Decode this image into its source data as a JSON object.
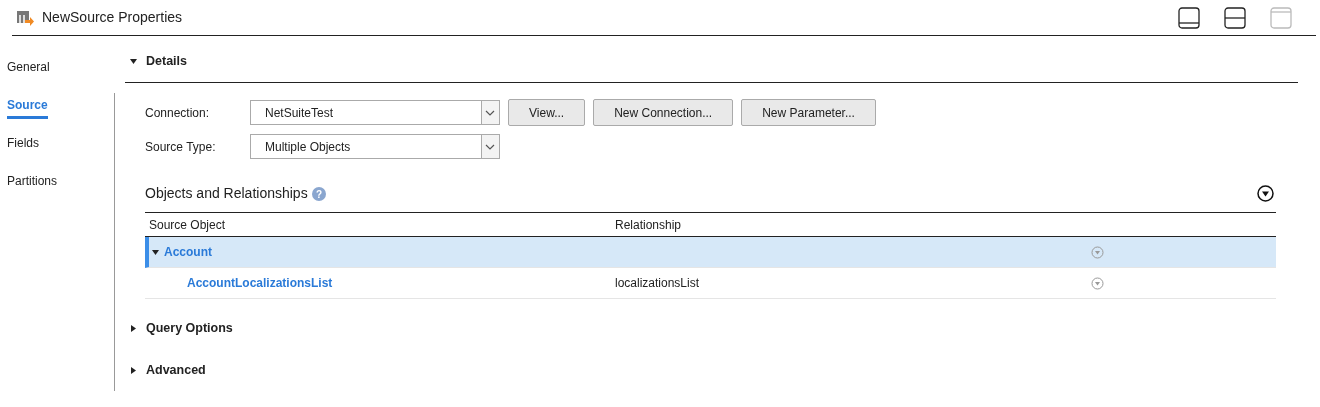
{
  "window": {
    "title": "NewSource Properties"
  },
  "sidebar": {
    "items": [
      {
        "label": "General",
        "selected": false
      },
      {
        "label": "Source",
        "selected": true
      },
      {
        "label": "Fields",
        "selected": false
      },
      {
        "label": "Partitions",
        "selected": false
      }
    ]
  },
  "sections": [
    {
      "title": "Details",
      "expanded": true
    },
    {
      "title": "Query Options",
      "expanded": false
    },
    {
      "title": "Advanced",
      "expanded": false
    }
  ],
  "form": [
    {
      "label": "Connection:",
      "value": "NetSuiteTest",
      "buttons": [
        "View...",
        "New Connection...",
        "New Parameter..."
      ]
    },
    {
      "label": "Source Type:",
      "value": "Multiple Objects"
    }
  ],
  "objects": {
    "title": "Objects and Relationships",
    "help": "?",
    "columns": [
      "Source Object",
      "Relationship"
    ],
    "rows": [
      {
        "name": "Account",
        "relationship": "",
        "selected": true,
        "expanded": true,
        "children": [
          {
            "name": "AccountLocalizationsList",
            "relationship": "localizationsList",
            "selected": false
          }
        ]
      }
    ]
  }
}
